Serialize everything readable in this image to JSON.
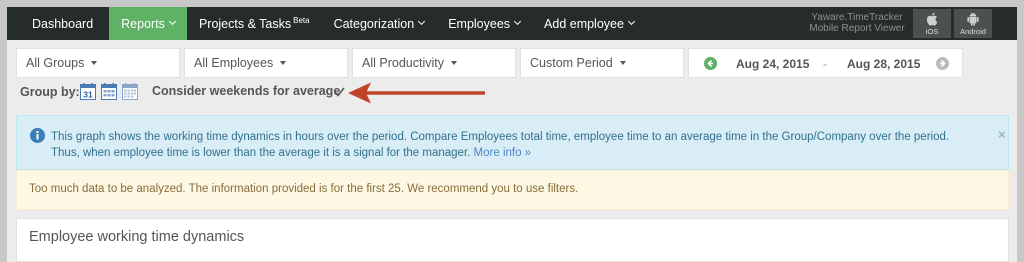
{
  "nav": {
    "items": [
      {
        "label": "Dashboard",
        "has_caret": false
      },
      {
        "label": "Reports",
        "has_caret": true,
        "active": true
      },
      {
        "label": "Projects & Tasks",
        "badge": "Beta",
        "has_caret": false
      },
      {
        "label": "Categorization",
        "has_caret": true
      },
      {
        "label": "Employees",
        "has_caret": true
      },
      {
        "label": "Add employee",
        "has_caret": true
      }
    ],
    "mobile": {
      "line1": "Yaware.TimeTracker",
      "line2": "Mobile Report Viewer",
      "ios_label": "iOS",
      "android_label": "Android"
    }
  },
  "filters": {
    "groups": "All Groups",
    "employees": "All Employees",
    "productivity": "All Productivity",
    "period": "Custom Period",
    "date_from": "Aug 24, 2015",
    "date_sep": "-",
    "date_to": "Aug 28, 2015"
  },
  "group_by": {
    "label": "Group by:",
    "day_number": "31",
    "weekends_label": "Consider weekends for average",
    "weekends_checked": true
  },
  "alerts": {
    "info_line1": "This graph shows the working time dynamics in hours over the period. Compare Employees total time, employee time to an average time in the Group/Company over the period.",
    "info_line2": "Thus, when employee time is lower than the average it is a signal for the manager.",
    "info_link": "More info »",
    "close": "×",
    "warning": "Too much data to be analyzed. The information provided is for the first 25. We recommend you to use filters."
  },
  "panel": {
    "title": "Employee working time dynamics"
  },
  "colors": {
    "nav_bg": "#262c2c",
    "active_bg": "#5fb165",
    "arrow": "#c0432c",
    "nav_circle_green": "#5fb165",
    "nav_circle_gray": "#bbbbbb"
  }
}
